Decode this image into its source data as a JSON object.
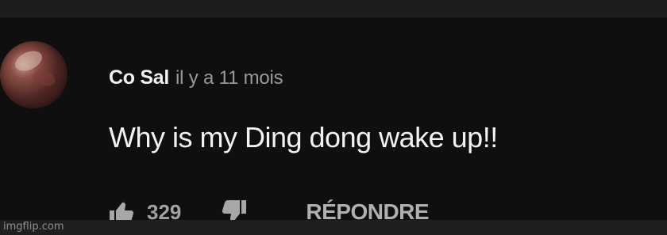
{
  "comment": {
    "author": "Co Sal",
    "time": "il y a 11 mois",
    "text": "Why is my Ding dong wake up!!",
    "like_count": "329",
    "reply_label": "RÉPONDRE",
    "avatar_icon": "avatar",
    "like_icon": "thumbs-up-icon",
    "dislike_icon": "thumbs-down-icon"
  },
  "watermark": "imgflip.com",
  "colors": {
    "background": "#0f0f0f",
    "text_primary": "#f2f2f2",
    "text_secondary": "#9a9a9a",
    "icon": "#a4a4a4"
  }
}
